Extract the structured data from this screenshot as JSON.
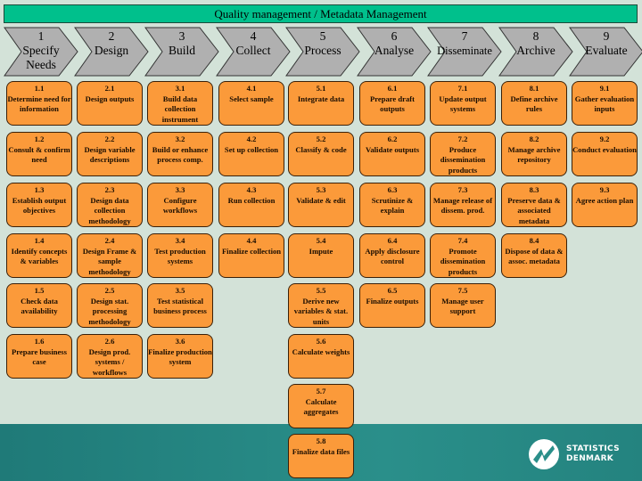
{
  "header": {
    "title": "Quality management / Metadata Management"
  },
  "colors": {
    "phase": "#b0b0b0",
    "subprocess": "#fb9a3a",
    "header_bar": "#00c08c",
    "background": "#d3e2d8",
    "footer": "#2a8f8a"
  },
  "phases": [
    {
      "number": "1",
      "name": "Specify Needs",
      "subprocesses": [
        {
          "id": "1.1",
          "label": "Determine need for information"
        },
        {
          "id": "1.2",
          "label": "Consult & confirm need"
        },
        {
          "id": "1.3",
          "label": "Establish output objectives"
        },
        {
          "id": "1.4",
          "label": "Identify concepts & variables"
        },
        {
          "id": "1.5",
          "label": "Check data availability"
        },
        {
          "id": "1.6",
          "label": "Prepare business case"
        }
      ]
    },
    {
      "number": "2",
      "name": "Design",
      "subprocesses": [
        {
          "id": "2.1",
          "label": "Design outputs"
        },
        {
          "id": "2.2",
          "label": "Design variable descriptions"
        },
        {
          "id": "2.3",
          "label": "Design data collection methodology"
        },
        {
          "id": "2.4",
          "label": "Design Frame & sample methodology"
        },
        {
          "id": "2.5",
          "label": "Design stat. processing methodology"
        },
        {
          "id": "2.6",
          "label": "Design prod. systems / workflows"
        }
      ]
    },
    {
      "number": "3",
      "name": "Build",
      "subprocesses": [
        {
          "id": "3.1",
          "label": "Build data collection instrument"
        },
        {
          "id": "3.2",
          "label": "Build or enhance process comp."
        },
        {
          "id": "3.3",
          "label": "Configure workflows"
        },
        {
          "id": "3.4",
          "label": "Test production systems"
        },
        {
          "id": "3.5",
          "label": "Test statistical business process"
        },
        {
          "id": "3.6",
          "label": "Finalize production system"
        }
      ]
    },
    {
      "number": "4",
      "name": "Collect",
      "subprocesses": [
        {
          "id": "4.1",
          "label": "Select sample"
        },
        {
          "id": "4.2",
          "label": "Set up collection"
        },
        {
          "id": "4.3",
          "label": "Run collection"
        },
        {
          "id": "4.4",
          "label": "Finalize collection"
        }
      ]
    },
    {
      "number": "5",
      "name": "Process",
      "subprocesses": [
        {
          "id": "5.1",
          "label": "Integrate data"
        },
        {
          "id": "5.2",
          "label": "Classify & code"
        },
        {
          "id": "5.3",
          "label": "Validate & edit"
        },
        {
          "id": "5.4",
          "label": "Impute"
        },
        {
          "id": "5.5",
          "label": "Derive new variables & stat. units"
        },
        {
          "id": "5.6",
          "label": "Calculate weights"
        },
        {
          "id": "5.7",
          "label": "Calculate aggregates"
        },
        {
          "id": "5.8",
          "label": "Finalize data files"
        }
      ]
    },
    {
      "number": "6",
      "name": "Analyse",
      "subprocesses": [
        {
          "id": "6.1",
          "label": "Prepare draft outputs"
        },
        {
          "id": "6.2",
          "label": "Validate outputs"
        },
        {
          "id": "6.3",
          "label": "Scrutinize & explain"
        },
        {
          "id": "6.4",
          "label": "Apply disclosure control"
        },
        {
          "id": "6.5",
          "label": "Finalize outputs"
        }
      ]
    },
    {
      "number": "7",
      "name": "Disseminate",
      "subprocesses": [
        {
          "id": "7.1",
          "label": "Update output systems"
        },
        {
          "id": "7.2",
          "label": "Produce dissemination products"
        },
        {
          "id": "7.3",
          "label": "Manage release of dissem. prod."
        },
        {
          "id": "7.4",
          "label": "Promote dissemination products"
        },
        {
          "id": "7.5",
          "label": "Manage user support"
        }
      ]
    },
    {
      "number": "8",
      "name": "Archive",
      "subprocesses": [
        {
          "id": "8.1",
          "label": "Define archive rules"
        },
        {
          "id": "8.2",
          "label": "Manage archive repository"
        },
        {
          "id": "8.3",
          "label": "Preserve data & associated metadata"
        },
        {
          "id": "8.4",
          "label": "Dispose of data & assoc. metadata"
        }
      ]
    },
    {
      "number": "9",
      "name": "Evaluate",
      "subprocesses": [
        {
          "id": "9.1",
          "label": "Gather evaluation inputs"
        },
        {
          "id": "9.2",
          "label": "Conduct evaluation"
        },
        {
          "id": "9.3",
          "label": "Agree action plan"
        }
      ]
    }
  ],
  "logo": {
    "line1": "STATISTICS",
    "line2": "DENMARK"
  }
}
